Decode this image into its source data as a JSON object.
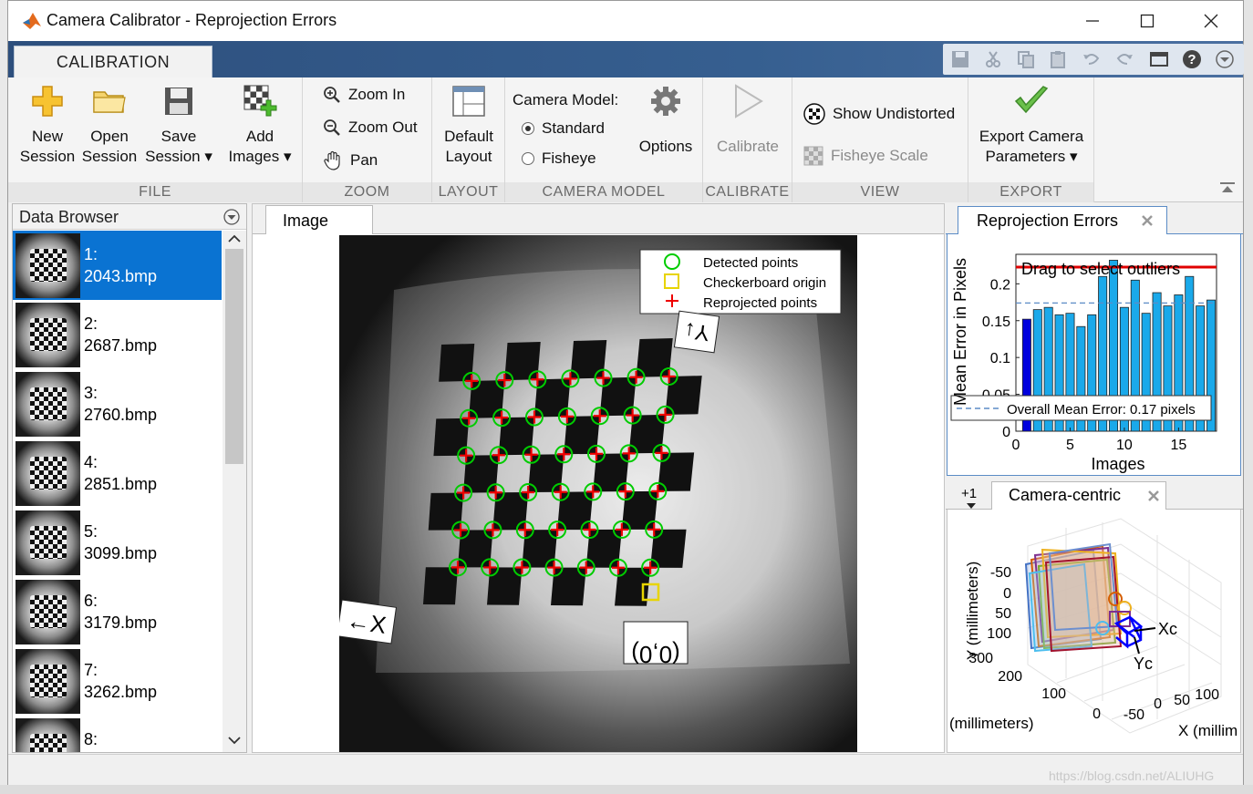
{
  "window": {
    "title": "Camera Calibrator - Reprojection Errors",
    "controls": {
      "minimize": "—",
      "maximize": "☐",
      "close": "✕"
    }
  },
  "ribbon": {
    "tab": "CALIBRATION",
    "sections": {
      "file": {
        "label": "FILE",
        "new_session": [
          "New",
          "Session"
        ],
        "open_session": [
          "Open",
          "Session"
        ],
        "save_session": [
          "Save",
          "Session ▾"
        ],
        "add_images": [
          "Add",
          "Images ▾"
        ]
      },
      "zoom": {
        "label": "ZOOM",
        "zoom_in": "Zoom In",
        "zoom_out": "Zoom Out",
        "pan": "Pan"
      },
      "layout": {
        "label": "LAYOUT",
        "default_layout": [
          "Default",
          "Layout"
        ]
      },
      "camera_model": {
        "label": "CAMERA MODEL",
        "heading": "Camera Model:",
        "standard": "Standard",
        "fisheye": "Fisheye",
        "selected": "Standard",
        "options": "Options"
      },
      "calibrate": {
        "label": "CALIBRATE",
        "button": "Calibrate"
      },
      "view": {
        "label": "VIEW",
        "show_undistorted": "Show Undistorted",
        "fisheye_scale": "Fisheye Scale"
      },
      "export": {
        "label": "EXPORT",
        "button": [
          "Export Camera",
          "Parameters ▾"
        ]
      }
    },
    "icons": [
      "new-session-icon",
      "open-folder-icon",
      "save-disk-icon",
      "add-images-icon",
      "zoom-in-icon",
      "zoom-out-icon",
      "pan-hand-icon",
      "layout-grid-icon",
      "options-gear-icon",
      "calibrate-play-icon",
      "checkerboard-icon",
      "fisheye-scale-icon",
      "export-checkmark-icon"
    ]
  },
  "data_browser": {
    "title": "Data Browser",
    "items": [
      {
        "index": "1:",
        "file": "2043.bmp",
        "selected": true
      },
      {
        "index": "2:",
        "file": "2687.bmp"
      },
      {
        "index": "3:",
        "file": "2760.bmp"
      },
      {
        "index": "4:",
        "file": "2851.bmp"
      },
      {
        "index": "5:",
        "file": "3099.bmp"
      },
      {
        "index": "6:",
        "file": "3179.bmp"
      },
      {
        "index": "7:",
        "file": "3262.bmp"
      },
      {
        "index": "8:",
        "file": ""
      }
    ]
  },
  "image_panel": {
    "tab": "Image",
    "legend": [
      "Detected points",
      "Checkerboard origin",
      "Reprojected points"
    ],
    "axis_labels": {
      "y": "Y↓",
      "x": "←X",
      "origin": "(0,0)"
    }
  },
  "reprojection_panel": {
    "tab": "Reprojection Errors",
    "overlay_text": "Drag to select outliers",
    "mean_legend": "Overall Mean Error: 0.17 pixels"
  },
  "camera_panel": {
    "tab": "Camera-centric",
    "extra_tab": "+1",
    "labels": {
      "y_axis": "Y (millimeters)",
      "z_axis": "(millimeters)",
      "x_axis": "X (millim",
      "xc": "Xc",
      "yc": "Yc",
      "y_ticks": [
        "-50",
        "0",
        "50",
        "100"
      ],
      "z_ticks": [
        "300",
        "200",
        "100",
        "0"
      ],
      "x_ticks": [
        "-50",
        "0",
        "50",
        "100"
      ]
    }
  },
  "watermark": "https://blog.csdn.net/ALIUHG",
  "colors": {
    "selection": "#0a73d2",
    "ribbon_band": "#2e5a8c",
    "bar": "#1aa9ea",
    "bar_selected": "#0000dd",
    "outlier_line": "#e00000",
    "detected": "#00cc00",
    "reprojected": "#ee0000",
    "origin": "#e8d400"
  },
  "chart_data": {
    "type": "bar",
    "title": "",
    "xlabel": "Images",
    "ylabel": "Mean Error in Pixels",
    "categories": [
      1,
      2,
      3,
      4,
      5,
      6,
      7,
      8,
      9,
      10,
      11,
      12,
      13,
      14,
      15,
      16,
      17,
      18
    ],
    "values": [
      0.152,
      0.165,
      0.168,
      0.158,
      0.16,
      0.142,
      0.158,
      0.21,
      0.232,
      0.168,
      0.205,
      0.16,
      0.188,
      0.17,
      0.185,
      0.21,
      0.17,
      0.178
    ],
    "selected_index": 0,
    "mean": 0.174,
    "ylim": [
      0,
      0.24
    ],
    "xlim": [
      0,
      18.5
    ],
    "y_ticks": [
      0,
      0.05,
      0.1,
      0.15,
      0.2
    ],
    "y_tick_labels": [
      "0",
      "0.05",
      "0.1",
      "0.15",
      "0.2"
    ],
    "x_ticks": [
      0,
      5,
      10,
      15
    ],
    "x_tick_labels": [
      "0",
      "5",
      "10",
      "15"
    ]
  }
}
